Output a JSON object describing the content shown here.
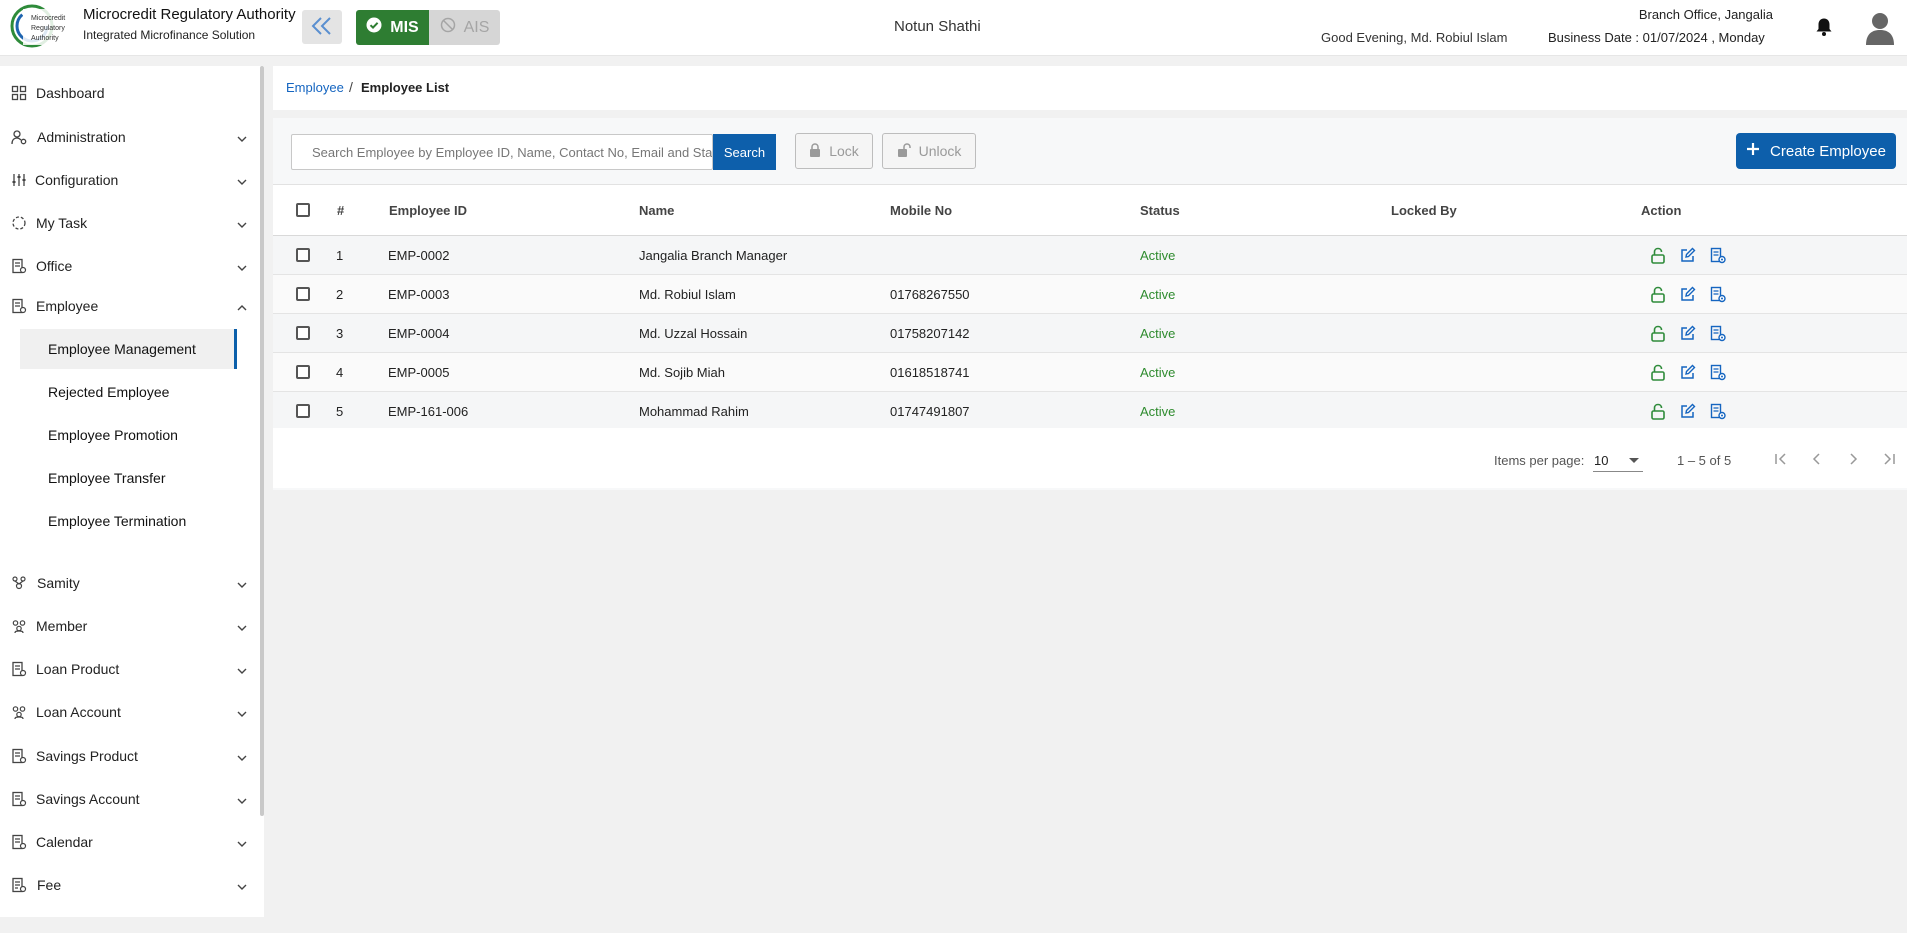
{
  "header": {
    "brand_title": "Microcredit Regulatory Authority",
    "brand_subtitle": "Integrated Microfinance Solution",
    "logo_text": [
      "Microcredit",
      "Regulatory",
      "Authority"
    ],
    "mode_mis": "MIS",
    "mode_ais": "AIS",
    "org_name": "Notun Shathi",
    "greeting": "Good Evening, Md. Robiul Islam",
    "branch_office": "Branch Office, Jangalia",
    "business_date": "Business Date : 01/07/2024 , Monday"
  },
  "sidebar": {
    "items": [
      {
        "label": "Dashboard",
        "icon": "dashboard-icon"
      },
      {
        "label": "Administration",
        "icon": "admin-icon"
      },
      {
        "label": "Configuration",
        "icon": "sliders-icon"
      },
      {
        "label": "My Task",
        "icon": "task-icon"
      },
      {
        "label": "Office",
        "icon": "office-icon"
      },
      {
        "label": "Employee",
        "icon": "employee-icon"
      },
      {
        "label": "Samity",
        "icon": "samity-icon"
      },
      {
        "label": "Member",
        "icon": "member-icon"
      },
      {
        "label": "Loan Product",
        "icon": "loan-product-icon"
      },
      {
        "label": "Loan Account",
        "icon": "loan-account-icon"
      },
      {
        "label": "Savings Product",
        "icon": "savings-product-icon"
      },
      {
        "label": "Savings Account",
        "icon": "savings-account-icon"
      },
      {
        "label": "Calendar",
        "icon": "calendar-icon"
      },
      {
        "label": "Fee",
        "icon": "fee-icon"
      }
    ],
    "employee_sub_items": [
      {
        "label": "Employee Management",
        "active": true
      },
      {
        "label": "Rejected Employee",
        "active": false
      },
      {
        "label": "Employee Promotion",
        "active": false
      },
      {
        "label": "Employee Transfer",
        "active": false
      },
      {
        "label": "Employee Termination",
        "active": false
      }
    ]
  },
  "breadcrumb": {
    "parent": "Employee",
    "separator": "/",
    "current": "Employee List"
  },
  "toolbar": {
    "search_placeholder": "Search Employee by Employee ID, Name, Contact No, Email and Status",
    "search_label": "Search",
    "lock_label": "Lock",
    "unlock_label": "Unlock",
    "create_label": "Create Employee"
  },
  "table": {
    "columns": [
      "#",
      "Employee ID",
      "Name",
      "Mobile No",
      "Status",
      "Locked By",
      "Action"
    ],
    "rows": [
      {
        "num": "1",
        "employee_id": "EMP-0002",
        "name": "Jangalia Branch Manager",
        "mobile": "",
        "status": "Active",
        "locked_by": ""
      },
      {
        "num": "2",
        "employee_id": "EMP-0003",
        "name": "Md. Robiul Islam",
        "mobile": "01768267550",
        "status": "Active",
        "locked_by": ""
      },
      {
        "num": "3",
        "employee_id": "EMP-0004",
        "name": "Md. Uzzal Hossain",
        "mobile": "01758207142",
        "status": "Active",
        "locked_by": ""
      },
      {
        "num": "4",
        "employee_id": "EMP-0005",
        "name": "Md. Sojib Miah",
        "mobile": "01618518741",
        "status": "Active",
        "locked_by": ""
      },
      {
        "num": "5",
        "employee_id": "EMP-161-006",
        "name": "Mohammad Rahim",
        "mobile": "01747491807",
        "status": "Active",
        "locked_by": ""
      }
    ]
  },
  "paginator": {
    "items_per_page_label": "Items per page:",
    "items_per_page_value": "10",
    "range_label": "1 – 5 of 5"
  },
  "colors": {
    "primary": "#0d5fab",
    "mis_green": "#2e7d32",
    "status_active": "#2e8b2e",
    "link_blue": "#1565c0"
  }
}
